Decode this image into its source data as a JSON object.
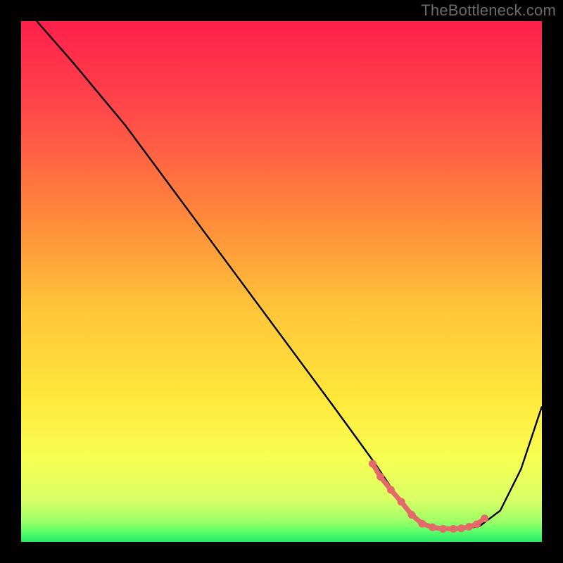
{
  "watermark": "TheBottleneck.com",
  "chart_data": {
    "type": "line",
    "title": "",
    "xlabel": "",
    "ylabel": "",
    "xlim": [
      0,
      100
    ],
    "ylim": [
      0,
      100
    ],
    "series": [
      {
        "name": "curve",
        "x": [
          3,
          10,
          20,
          30,
          40,
          50,
          60,
          68,
          72,
          75,
          78,
          82,
          85,
          88,
          92,
          96,
          100
        ],
        "y": [
          100,
          92,
          80,
          66.5,
          53,
          39.5,
          26,
          15,
          9,
          5,
          3,
          2.5,
          2.5,
          3,
          6,
          14,
          26
        ]
      },
      {
        "name": "highlight",
        "x": [
          67.5,
          69,
          71,
          73,
          75,
          77,
          79,
          81,
          83,
          84.5,
          86,
          87.5,
          89
        ],
        "y": [
          15.0,
          12.5,
          10.0,
          7.7,
          5.2,
          3.5,
          2.8,
          2.5,
          2.5,
          2.6,
          2.9,
          3.4,
          4.5
        ]
      }
    ],
    "gradient_stops": [
      {
        "offset": 0,
        "color": "#ff1f4b"
      },
      {
        "offset": 18,
        "color": "#ff4a4a"
      },
      {
        "offset": 38,
        "color": "#ff8a3a"
      },
      {
        "offset": 55,
        "color": "#ffc43a"
      },
      {
        "offset": 72,
        "color": "#ffe73a"
      },
      {
        "offset": 84,
        "color": "#f7ff52"
      },
      {
        "offset": 92,
        "color": "#d8ff66"
      },
      {
        "offset": 96,
        "color": "#9fff66"
      },
      {
        "offset": 98,
        "color": "#5cff68"
      },
      {
        "offset": 100,
        "color": "#22e86a"
      }
    ],
    "curve_stroke": "#000000",
    "highlight_stroke": "#e46a6a",
    "highlight_dot_fill": "#e46a6a"
  }
}
